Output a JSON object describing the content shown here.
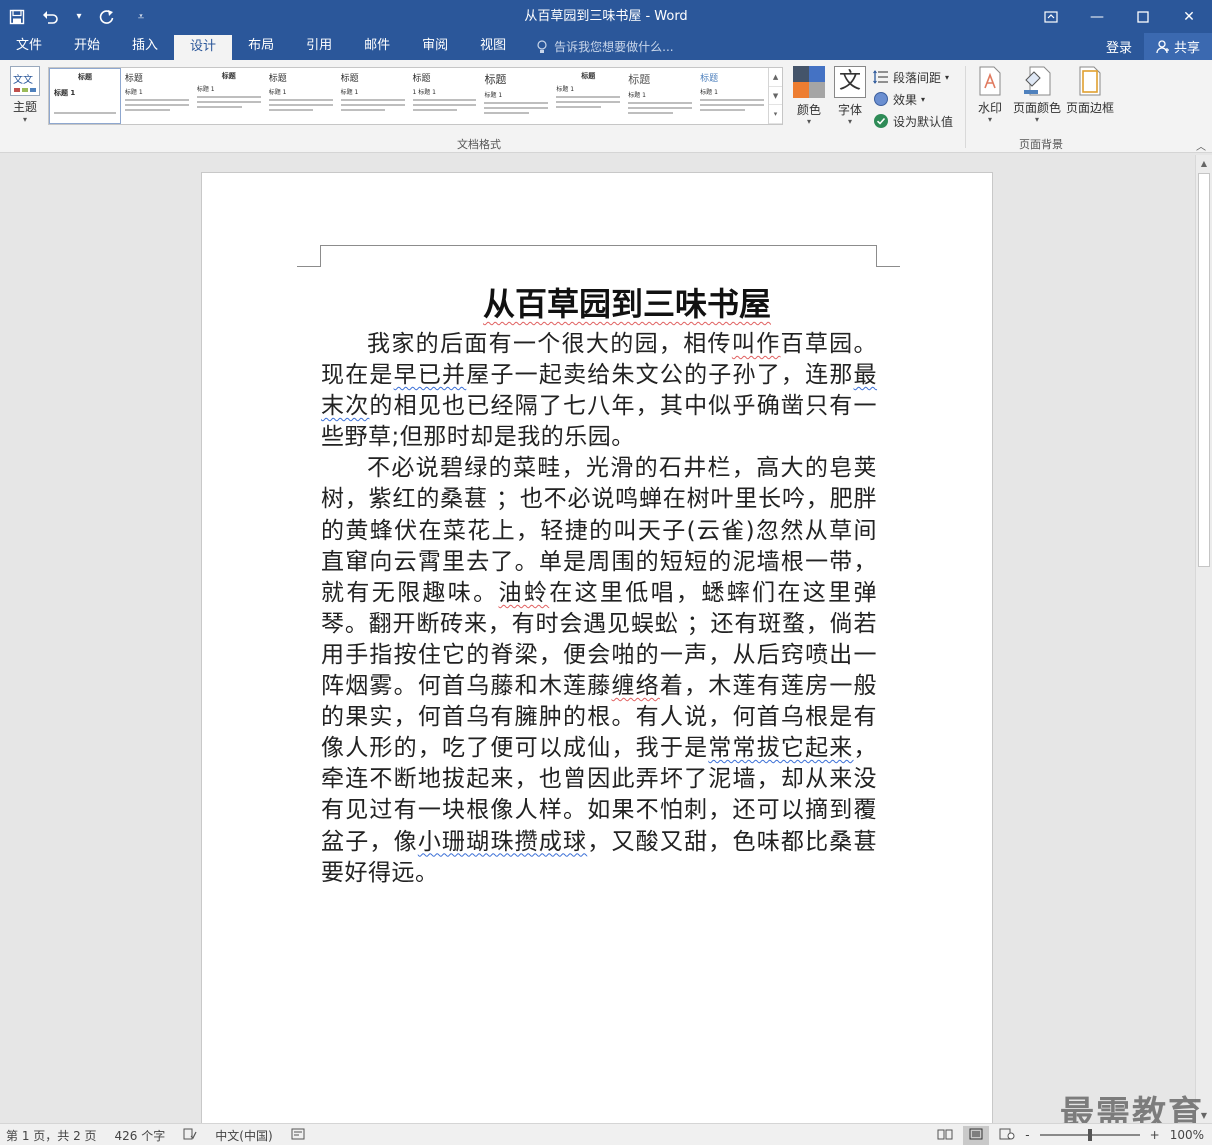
{
  "app": {
    "window_title": "从百草园到三味书屋 - Word",
    "colors": {
      "ribbon_blue": "#2b579a",
      "spell_error": "#e06060",
      "grammar_error": "#3a6fd6"
    }
  },
  "qat": {
    "save_icon": "save-icon",
    "undo_icon": "undo-icon",
    "redo_icon": "redo-icon"
  },
  "tabs": [
    {
      "label": "文件"
    },
    {
      "label": "开始"
    },
    {
      "label": "插入"
    },
    {
      "label": "设计",
      "active": true
    },
    {
      "label": "布局"
    },
    {
      "label": "引用"
    },
    {
      "label": "邮件"
    },
    {
      "label": "审阅"
    },
    {
      "label": "视图"
    }
  ],
  "tellme": {
    "placeholder": "告诉我您想要做什么..."
  },
  "account": {
    "login": "登录",
    "share": "共享"
  },
  "ribbon": {
    "theme_label": "主题",
    "theme_icon_text": "文文",
    "gallery": [
      {
        "title": "标题",
        "heading": "标题 1",
        "centered": true
      },
      {
        "title": "标题",
        "heading": "标题 1"
      },
      {
        "title": "标题",
        "heading": "标题 1"
      },
      {
        "title": "标题",
        "heading": "标题 1"
      },
      {
        "title": "标题",
        "heading": "标题 1"
      },
      {
        "title": "标题",
        "heading": "1 标题 1"
      },
      {
        "title": "标题",
        "heading": "标题 1"
      },
      {
        "title": "标题",
        "heading": "标题 1"
      },
      {
        "title": "标题",
        "heading": "标题 1"
      },
      {
        "title": "标题",
        "heading": "标题 1"
      }
    ],
    "colors_label": "颜色",
    "fonts_label": "字体",
    "fonts_icon_text": "文",
    "paragraph_spacing": "段落间距",
    "effects": "效果",
    "set_default": "设为默认值",
    "group_doc_format": "文档格式",
    "watermark_label": "水印",
    "page_color_label": "页面颜色",
    "page_border_label": "页面边框",
    "group_page_bg": "页面背景"
  },
  "document": {
    "title": "从百草园到三味书屋",
    "p1": {
      "a": "我家的后面有一个很大的园，相传",
      "b": "叫作",
      "c": "百草园。现在是",
      "d": "早已并",
      "e": "屋子一起卖给朱文公的子孙了，连那",
      "f": "最末次",
      "g": "的相见也已经隔了七八年，其中似乎确凿只有一些野草;但那时却是我的乐园。"
    },
    "p2": {
      "a": "不必说碧绿的菜畦，光滑的石井栏，高大的皂荚树，紫红的桑葚 ；也不必说鸣蝉在树叶里长吟，肥胖的黄蜂伏在菜花上，轻捷的叫天子(云雀)忽然从草间直窜向云霄里去了。单是周围的短短的泥墙根一带，就有无限趣味。",
      "b": "油蛉",
      "c": "在这里低唱，蟋蟀们在这里弹琴。翻开断砖来，有时会遇见蜈蚣 ；还有斑蝥，倘若用手指按住它的脊梁，便会啪的一声，从后窍喷出一阵烟雾。何首乌藤和木莲藤",
      "d": "缠络",
      "e": "着，木莲有莲房一般的果实，何首乌有臃肿的根。有人说，何首乌根是有像人形的，吃了便可以成仙，我于是",
      "f": "常常拔它起来",
      "g": "，牵连不断地拔起来，也曾因此弄坏了泥墙，却从来没有见过有一块根像人样。如果不怕刺，还可以摘到覆盆子，像",
      "h": "小珊瑚珠攒成球",
      "i": "，又酸又甜，色味都比桑葚要好得远。"
    }
  },
  "watermark": "最需教育",
  "status": {
    "page": "第 1 页，共 2 页",
    "words": "426 个字",
    "language": "中文(中国)",
    "zoom": "100%",
    "zoom_minus": "-",
    "zoom_plus": "+"
  }
}
